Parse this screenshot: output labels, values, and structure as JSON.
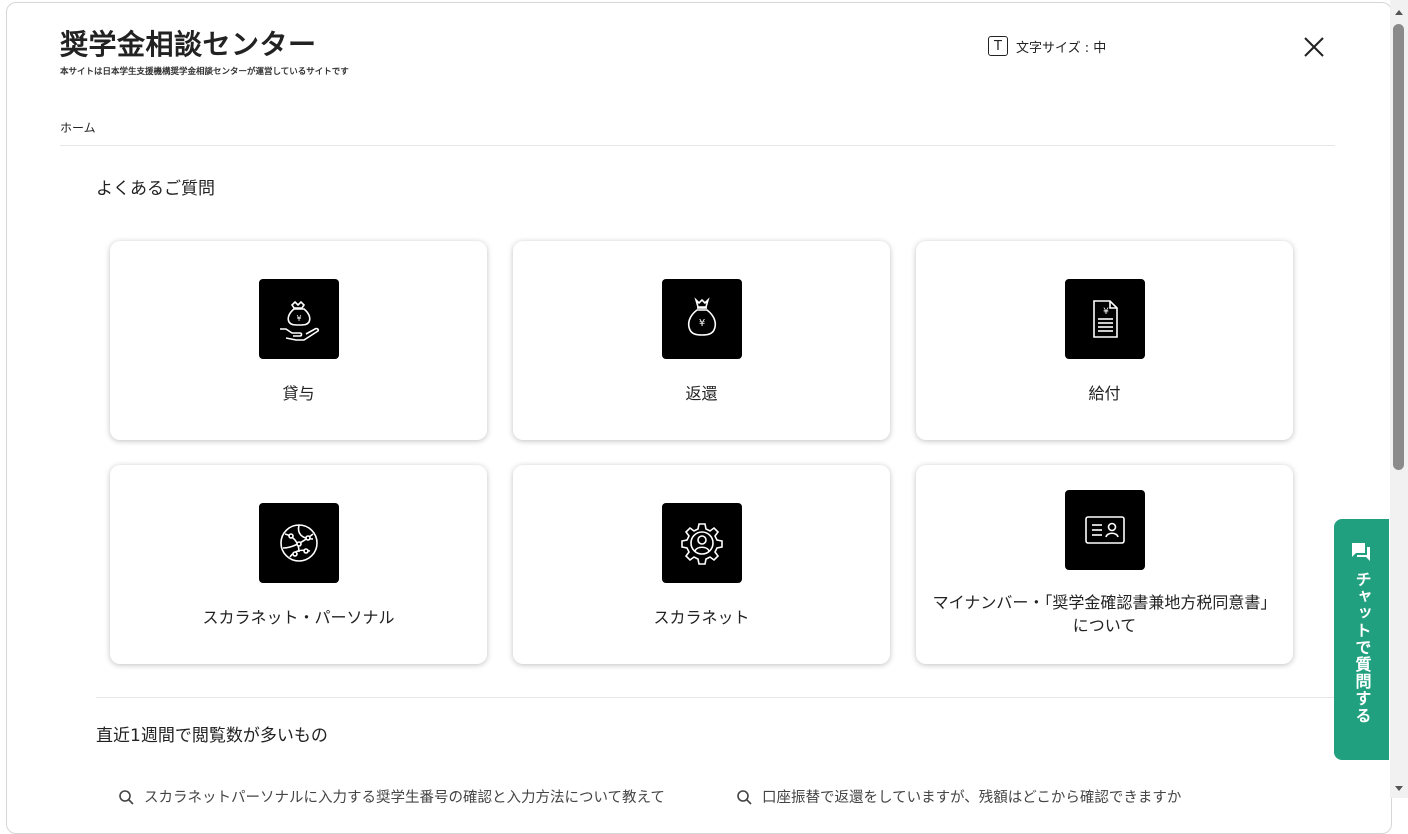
{
  "header": {
    "title": "奨学金相談センター",
    "subtitle": "本サイトは日本学生支援機構奨学金相談センターが運営しているサイトです",
    "text_size_icon": "T",
    "text_size_label": "文字サイズ : 中"
  },
  "breadcrumb": "ホーム",
  "faq": {
    "heading": "よくあるご質問",
    "cards": [
      {
        "label": "貸与",
        "icon": "money-bag-hand-icon"
      },
      {
        "label": "返還",
        "icon": "money-bag-icon"
      },
      {
        "label": "給付",
        "icon": "document-yen-icon"
      },
      {
        "label": "スカラネット・パーソナル",
        "icon": "globe-network-icon"
      },
      {
        "label": "スカラネット",
        "icon": "gear-user-icon"
      },
      {
        "label": "マイナンバー・「奨学金確認書兼地方税同意書」",
        "label2": "について",
        "icon": "id-card-icon"
      }
    ]
  },
  "popular": {
    "heading": "直近1週間で閲覧数が多いもの",
    "items": [
      "スカラネットパーソナルに入力する奨学生番号の確認と入力方法について教えて",
      "口座振替で返還をしていますが、残額はどこから確認できますか"
    ]
  },
  "chat": {
    "label": "チャットで質問する"
  },
  "colors": {
    "accent": "#21a07f",
    "icon_bg": "#000000"
  }
}
